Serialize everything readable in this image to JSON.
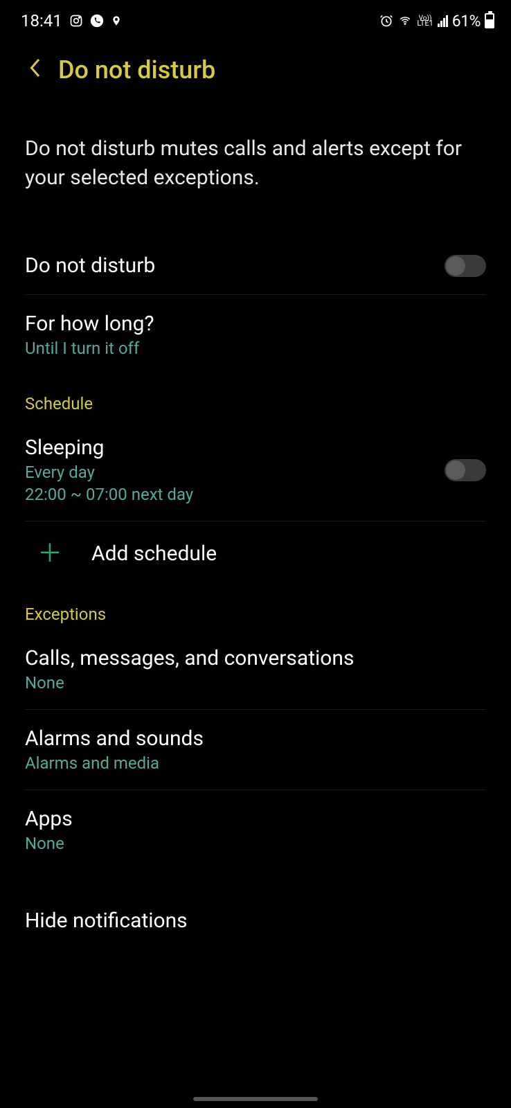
{
  "status": {
    "time": "18:41",
    "battery_pct": "61%"
  },
  "header": {
    "title": "Do not disturb"
  },
  "description": "Do not disturb mutes calls and alerts except for your selected exceptions.",
  "main_toggle": {
    "label": "Do not disturb",
    "on": false
  },
  "how_long": {
    "label": "For how long?",
    "value": "Until I turn it off"
  },
  "schedule": {
    "header": "Schedule",
    "items": [
      {
        "title": "Sleeping",
        "sub1": "Every day",
        "sub2": "22:00 ~ 07:00 next day",
        "on": false
      }
    ],
    "add_label": "Add schedule"
  },
  "exceptions": {
    "header": "Exceptions",
    "items": [
      {
        "title": "Calls, messages, and conversations",
        "sub": "None"
      },
      {
        "title": "Alarms and sounds",
        "sub": "Alarms and media"
      },
      {
        "title": "Apps",
        "sub": "None"
      }
    ]
  },
  "hide": {
    "label": "Hide notifications"
  }
}
